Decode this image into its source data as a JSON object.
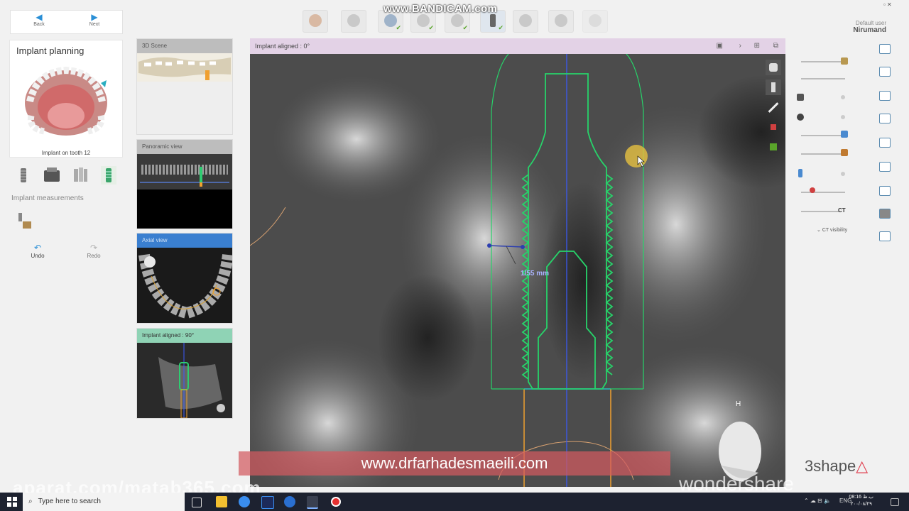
{
  "nav": {
    "back_label": "Back",
    "next_label": "Next"
  },
  "overlay": {
    "bandicam": "www.BANDICAM.com",
    "site": "www.drfarhadesmaeili.com",
    "aparat": "aparat.com/matab365.com",
    "wondershare": "wondershare"
  },
  "left_panel": {
    "title": "Implant planning",
    "caption": "Implant on tooth 12",
    "measurements_label": "Implant measurements",
    "undo_label": "Undo",
    "redo_label": "Redo"
  },
  "thumbnails": [
    {
      "label": "3D Scene"
    },
    {
      "label": "Panoramic view"
    },
    {
      "label": "Axial view"
    },
    {
      "label": "Implant aligned : 90°"
    }
  ],
  "main_view": {
    "title": "Implant aligned : 0°",
    "measurement": "1/55 mm",
    "orientation": "H"
  },
  "right_panel": {
    "user_role": "Default user",
    "user_name": "Nirumand",
    "ct_label": "CT",
    "ct_visibility_label": "CT visibility"
  },
  "brand": {
    "name": "3shape",
    "accent": "#e04050"
  },
  "taskbar": {
    "search_placeholder": "Type here to search",
    "lang": "ENG",
    "time": "08:16 ب.ظ",
    "date": "۲۰۰/۰۸/۲۹"
  },
  "colors": {
    "implant_outline": "#27d36a",
    "axis": "#3a5bff",
    "accent_blue": "#2a8fd6"
  }
}
